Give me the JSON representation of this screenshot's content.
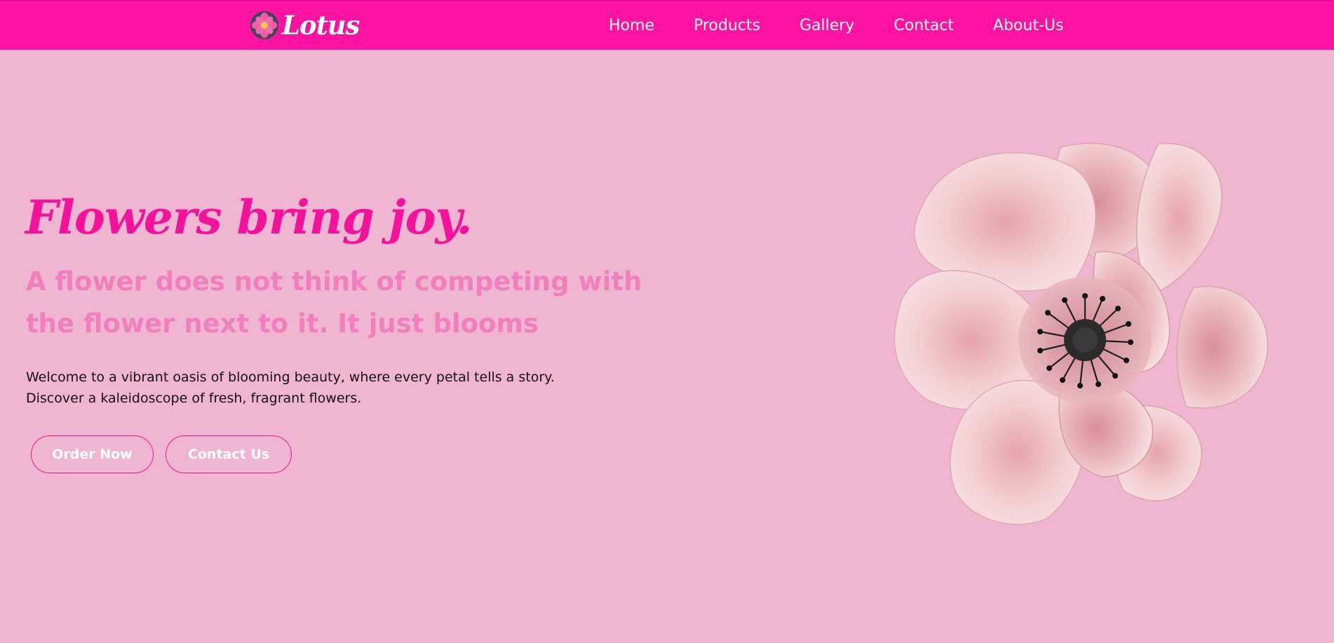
{
  "nav": {
    "brand": "Lotus",
    "brand_icon": "lotus-flower-logo-icon",
    "links": [
      "Home",
      "Products",
      "Gallery",
      "Contact",
      "About-Us"
    ]
  },
  "hero": {
    "title": "Flowers bring joy.",
    "quote": "A flower does not think of competing with the flower next to it. It just blooms",
    "description_lines": [
      "Welcome to a vibrant oasis of blooming beauty, where every petal tells a story.",
      "Discover a kaleidoscope of fresh, fragrant flowers."
    ],
    "primary_button": "Order Now",
    "secondary_button": "Contact Us",
    "image": "pink-watercolor-flower"
  },
  "colors": {
    "nav_background": "#fc13a1",
    "page_background": "#f0b6d1",
    "title": "#f5129a",
    "quote": "#f17fbe",
    "button_border": "#f5129a"
  }
}
